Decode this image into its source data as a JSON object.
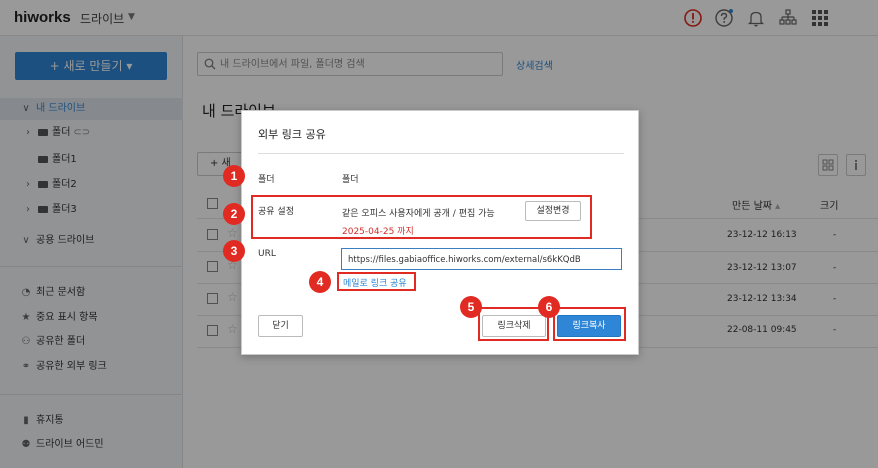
{
  "header": {
    "logo": "hiworks",
    "app_name": "드라이브",
    "icons": [
      "alert-icon",
      "help-icon",
      "bell-icon",
      "org-chart-icon",
      "apps-grid-icon"
    ]
  },
  "sidebar": {
    "new_button": "+ 새로 만들기 ▾",
    "my_drive": "내 드라이브",
    "folders": [
      "폴더",
      "폴더1",
      "폴더2",
      "폴더3"
    ],
    "shared_drive": "공용 드라이브",
    "items": [
      "최근 문서함",
      "중요 표시 항목",
      "공유한 폴더",
      "공유한 외부 링크"
    ],
    "bottom_items": [
      "휴지통",
      "드라이브 어드민"
    ]
  },
  "main": {
    "search_placeholder": "내 드라이브에서 파일, 폴더명 검색",
    "advanced_search": "상세검색",
    "title": "내 드라이브",
    "new_button": "+ 새",
    "columns": {
      "modified": "만든 날짜",
      "size": "크기"
    },
    "rows": [
      {
        "date": "23-12-12 16:13",
        "size": "-"
      },
      {
        "date": "23-12-12 13:07",
        "size": "-"
      },
      {
        "date": "23-12-12 13:34",
        "size": "-"
      },
      {
        "date": "22-08-11 09:45",
        "size": "-"
      }
    ]
  },
  "dialog": {
    "title": "외부 링크 공유",
    "folder_label": "폴더",
    "folder_value": "폴더",
    "share_label": "공유 설정",
    "share_value": "같은 오피스 사용자에게 공개 / 편집 가능",
    "expire_text": "2025-04-25 까지",
    "change_button": "설정변경",
    "url_label": "URL",
    "url_value": "https://files.gabiaoffice.hiworks.com/external/s6kKQdB",
    "mail_share": "메일로 링크 공유",
    "close_button": "닫기",
    "delete_button": "링크삭제",
    "copy_button": "링크복사"
  },
  "annotations": [
    "1",
    "2",
    "3",
    "4",
    "5",
    "6"
  ],
  "colors": {
    "accent": "#2f86d6",
    "annotation": "#e12a22",
    "expire": "#d0302b"
  }
}
